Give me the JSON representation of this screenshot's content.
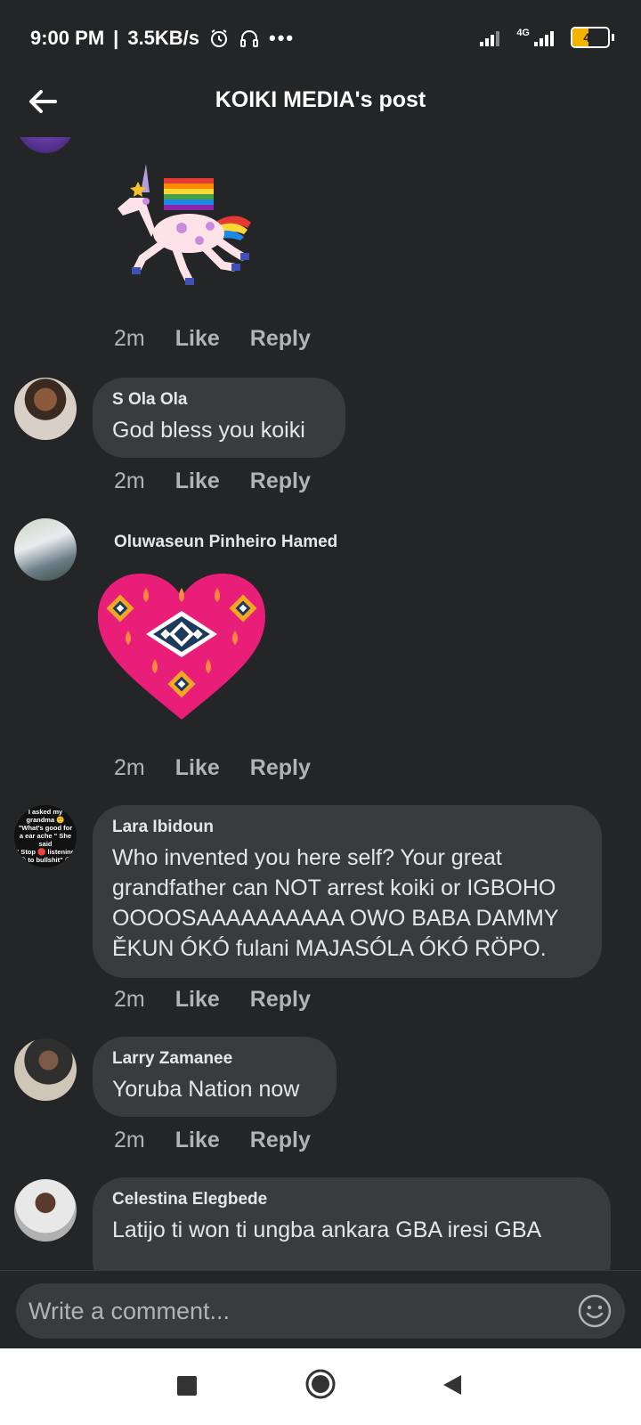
{
  "status": {
    "time": "9:00 PM",
    "speed": "3.5KB/s",
    "network": "4G",
    "battery": "45",
    "battery_level": 0.45
  },
  "header": {
    "title": "KOIKI MEDIA's post",
    "back_icon": "back-arrow-icon"
  },
  "comments": [
    {
      "id": "c1",
      "sticker": "unicorn-rainbow-flag-sticker",
      "time": "2m",
      "like": "Like",
      "reply": "Reply"
    },
    {
      "id": "c2",
      "name": "S Ola Ola",
      "text": "God bless you koiki",
      "time": "2m",
      "like": "Like",
      "reply": "Reply"
    },
    {
      "id": "c3",
      "name": "Oluwaseun Pinheiro Hamed",
      "sticker": "patterned-heart-sticker",
      "time": "2m",
      "like": "Like",
      "reply": "Reply"
    },
    {
      "id": "c4",
      "name": "Lara Ibidoun",
      "avatar_text": [
        "I asked my",
        "grandma 🤨",
        "\"What's good for",
        "a ear ache \" She",
        "said",
        "\" Stop 🛑 listening",
        "😒 to bullshit\" 😒"
      ],
      "text_lines": [
        "Who invented you here self? Your great",
        "grandfather can NOT arrest koiki or IGBOHO",
        "OOOOSAAAAAAAAAA OWO BABA DAMMY",
        "ĚKUN ÓKÓ fulani MAJASÓLA ÓKÓ RÖPO."
      ],
      "time": "2m",
      "like": "Like",
      "reply": "Reply"
    },
    {
      "id": "c5",
      "name": "Larry Zamanee",
      "text": "Yoruba Nation now",
      "time": "2m",
      "like": "Like",
      "reply": "Reply"
    },
    {
      "id": "c6",
      "name": "Celestina Elegbede",
      "text": "Latijo ti won ti ungba ankara GBA iresi GBA"
    }
  ],
  "composer": {
    "placeholder": "Write a comment...",
    "emoji_icon": "smiley-icon"
  },
  "navbar": {
    "items": [
      "recent-apps-button",
      "home-button",
      "back-button"
    ]
  }
}
